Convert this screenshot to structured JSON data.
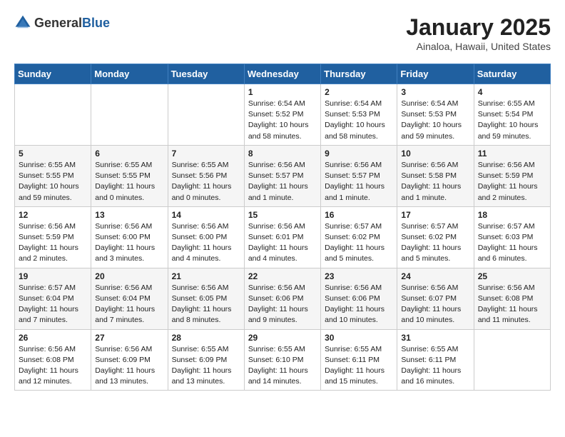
{
  "header": {
    "logo_general": "General",
    "logo_blue": "Blue",
    "month": "January 2025",
    "location": "Ainaloa, Hawaii, United States"
  },
  "weekdays": [
    "Sunday",
    "Monday",
    "Tuesday",
    "Wednesday",
    "Thursday",
    "Friday",
    "Saturday"
  ],
  "weeks": [
    [
      {
        "day": "",
        "info": ""
      },
      {
        "day": "",
        "info": ""
      },
      {
        "day": "",
        "info": ""
      },
      {
        "day": "1",
        "info": "Sunrise: 6:54 AM\nSunset: 5:52 PM\nDaylight: 10 hours\nand 58 minutes."
      },
      {
        "day": "2",
        "info": "Sunrise: 6:54 AM\nSunset: 5:53 PM\nDaylight: 10 hours\nand 58 minutes."
      },
      {
        "day": "3",
        "info": "Sunrise: 6:54 AM\nSunset: 5:53 PM\nDaylight: 10 hours\nand 59 minutes."
      },
      {
        "day": "4",
        "info": "Sunrise: 6:55 AM\nSunset: 5:54 PM\nDaylight: 10 hours\nand 59 minutes."
      }
    ],
    [
      {
        "day": "5",
        "info": "Sunrise: 6:55 AM\nSunset: 5:55 PM\nDaylight: 10 hours\nand 59 minutes."
      },
      {
        "day": "6",
        "info": "Sunrise: 6:55 AM\nSunset: 5:55 PM\nDaylight: 11 hours\nand 0 minutes."
      },
      {
        "day": "7",
        "info": "Sunrise: 6:55 AM\nSunset: 5:56 PM\nDaylight: 11 hours\nand 0 minutes."
      },
      {
        "day": "8",
        "info": "Sunrise: 6:56 AM\nSunset: 5:57 PM\nDaylight: 11 hours\nand 1 minute."
      },
      {
        "day": "9",
        "info": "Sunrise: 6:56 AM\nSunset: 5:57 PM\nDaylight: 11 hours\nand 1 minute."
      },
      {
        "day": "10",
        "info": "Sunrise: 6:56 AM\nSunset: 5:58 PM\nDaylight: 11 hours\nand 1 minute."
      },
      {
        "day": "11",
        "info": "Sunrise: 6:56 AM\nSunset: 5:59 PM\nDaylight: 11 hours\nand 2 minutes."
      }
    ],
    [
      {
        "day": "12",
        "info": "Sunrise: 6:56 AM\nSunset: 5:59 PM\nDaylight: 11 hours\nand 2 minutes."
      },
      {
        "day": "13",
        "info": "Sunrise: 6:56 AM\nSunset: 6:00 PM\nDaylight: 11 hours\nand 3 minutes."
      },
      {
        "day": "14",
        "info": "Sunrise: 6:56 AM\nSunset: 6:00 PM\nDaylight: 11 hours\nand 4 minutes."
      },
      {
        "day": "15",
        "info": "Sunrise: 6:56 AM\nSunset: 6:01 PM\nDaylight: 11 hours\nand 4 minutes."
      },
      {
        "day": "16",
        "info": "Sunrise: 6:57 AM\nSunset: 6:02 PM\nDaylight: 11 hours\nand 5 minutes."
      },
      {
        "day": "17",
        "info": "Sunrise: 6:57 AM\nSunset: 6:02 PM\nDaylight: 11 hours\nand 5 minutes."
      },
      {
        "day": "18",
        "info": "Sunrise: 6:57 AM\nSunset: 6:03 PM\nDaylight: 11 hours\nand 6 minutes."
      }
    ],
    [
      {
        "day": "19",
        "info": "Sunrise: 6:57 AM\nSunset: 6:04 PM\nDaylight: 11 hours\nand 7 minutes."
      },
      {
        "day": "20",
        "info": "Sunrise: 6:56 AM\nSunset: 6:04 PM\nDaylight: 11 hours\nand 7 minutes."
      },
      {
        "day": "21",
        "info": "Sunrise: 6:56 AM\nSunset: 6:05 PM\nDaylight: 11 hours\nand 8 minutes."
      },
      {
        "day": "22",
        "info": "Sunrise: 6:56 AM\nSunset: 6:06 PM\nDaylight: 11 hours\nand 9 minutes."
      },
      {
        "day": "23",
        "info": "Sunrise: 6:56 AM\nSunset: 6:06 PM\nDaylight: 11 hours\nand 10 minutes."
      },
      {
        "day": "24",
        "info": "Sunrise: 6:56 AM\nSunset: 6:07 PM\nDaylight: 11 hours\nand 10 minutes."
      },
      {
        "day": "25",
        "info": "Sunrise: 6:56 AM\nSunset: 6:08 PM\nDaylight: 11 hours\nand 11 minutes."
      }
    ],
    [
      {
        "day": "26",
        "info": "Sunrise: 6:56 AM\nSunset: 6:08 PM\nDaylight: 11 hours\nand 12 minutes."
      },
      {
        "day": "27",
        "info": "Sunrise: 6:56 AM\nSunset: 6:09 PM\nDaylight: 11 hours\nand 13 minutes."
      },
      {
        "day": "28",
        "info": "Sunrise: 6:55 AM\nSunset: 6:09 PM\nDaylight: 11 hours\nand 13 minutes."
      },
      {
        "day": "29",
        "info": "Sunrise: 6:55 AM\nSunset: 6:10 PM\nDaylight: 11 hours\nand 14 minutes."
      },
      {
        "day": "30",
        "info": "Sunrise: 6:55 AM\nSunset: 6:11 PM\nDaylight: 11 hours\nand 15 minutes."
      },
      {
        "day": "31",
        "info": "Sunrise: 6:55 AM\nSunset: 6:11 PM\nDaylight: 11 hours\nand 16 minutes."
      },
      {
        "day": "",
        "info": ""
      }
    ]
  ]
}
